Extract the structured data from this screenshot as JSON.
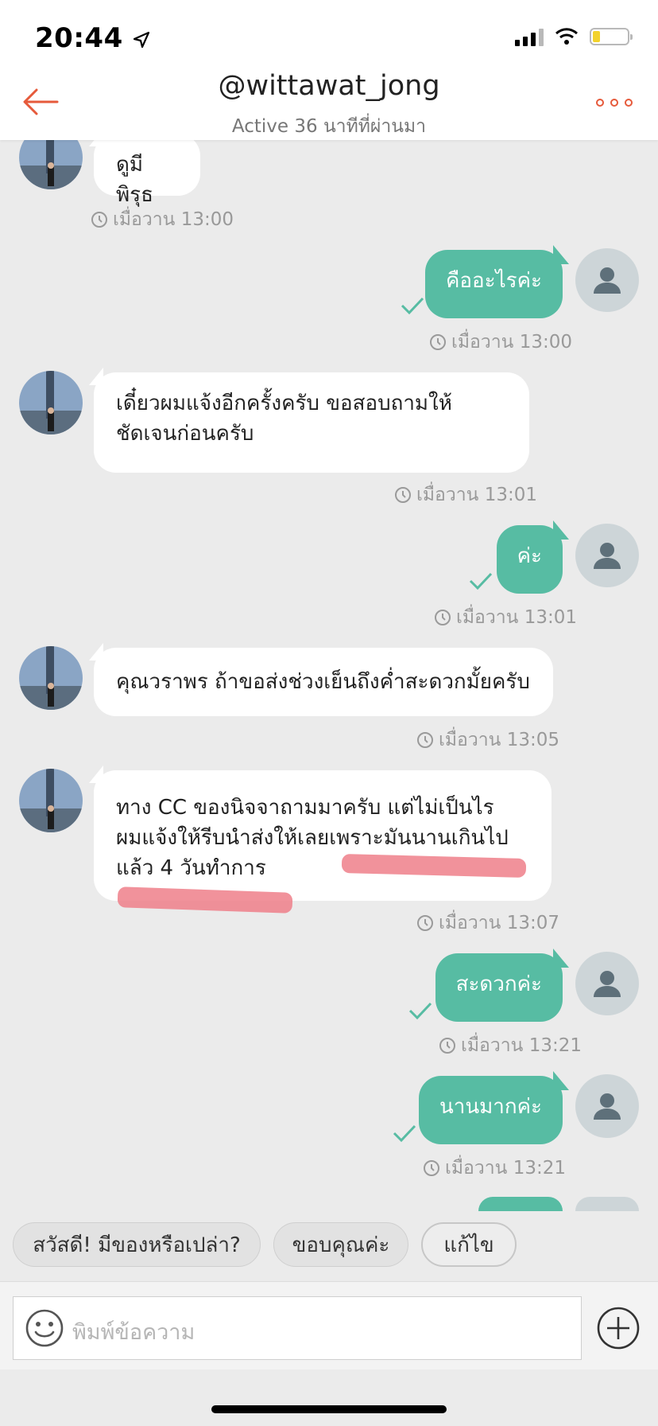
{
  "status": {
    "time": "20:44"
  },
  "header": {
    "title": "@wittawat_jong",
    "subtitle": "Active 36 นาทีที่ผ่านมา"
  },
  "messages": [
    {
      "dir": "in",
      "text": "ดูมีพิรุธ",
      "time": "เมื่อวาน 13:00"
    },
    {
      "dir": "out",
      "text": "คืออะไรค่ะ",
      "time": "เมื่อวาน 13:00"
    },
    {
      "dir": "in",
      "lines": [
        "เดี๋ยวผมแจ้งอีกครั้งครับ ขอสอบถามให้",
        "ชัดเจนก่อนครับ"
      ],
      "time": "เมื่อวาน 13:01"
    },
    {
      "dir": "out",
      "text": "ค่ะ",
      "time": "เมื่อวาน 13:01"
    },
    {
      "dir": "in",
      "text": "คุณวราพร ถ้าขอส่งช่วงเย็นถึงค่ำสะดวกมั้ยครับ",
      "time": "เมื่อวาน 13:05"
    },
    {
      "dir": "in",
      "lines": [
        "ทาง CC ของนิจจาถามมาครับ แต่ไม่เป็นไร",
        "ผมแจ้งให้รีบนำส่งให้เลยเพราะมันนานเกินไป",
        "แล้ว 4 วันทำการ"
      ],
      "time": "เมื่อวาน 13:07"
    },
    {
      "dir": "out",
      "text": "สะดวกค่ะ",
      "time": "เมื่อวาน 13:21"
    },
    {
      "dir": "out",
      "text": "นานมากค่ะ",
      "time": "เมื่อวาน 13:21"
    }
  ],
  "quick_replies": [
    "สวัสดี! มีของหรือเปล่า?",
    "ขอบคุณค่ะ",
    "แก้ไข"
  ],
  "composer": {
    "placeholder": "พิมพ์ข้อความ"
  },
  "colors": {
    "accent": "#e65a3b",
    "bubble_out": "#57bca3",
    "background": "#ebebeb",
    "highlight": "#ee7a85"
  }
}
